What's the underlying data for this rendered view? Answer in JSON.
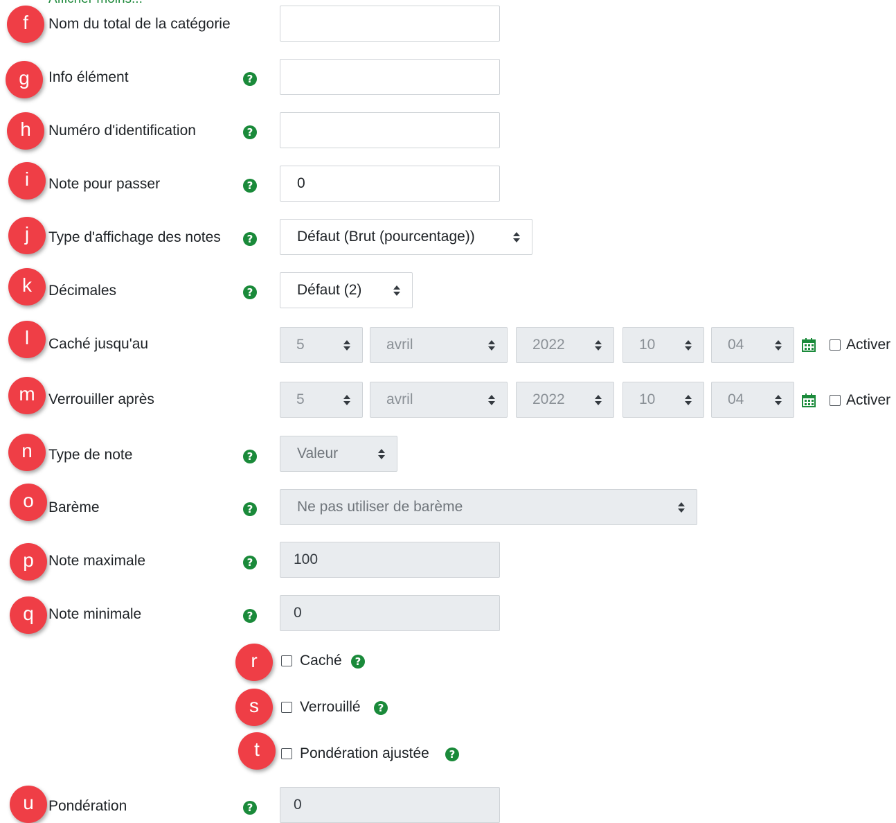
{
  "top_link": "Afficher moins...",
  "rows": [
    {
      "badge": "f",
      "label": "Nom du total de la catégorie",
      "value": ""
    },
    {
      "badge": "g",
      "label": "Info élément",
      "value": ""
    },
    {
      "badge": "h",
      "label": "Numéro d'identification",
      "value": ""
    },
    {
      "badge": "i",
      "label": "Note pour passer",
      "value": "0"
    },
    {
      "badge": "j",
      "label": "Type d'affichage des notes",
      "value": "Défaut (Brut (pourcentage))"
    },
    {
      "badge": "k",
      "label": "Décimales",
      "value": "Défaut (2)"
    },
    {
      "badge": "l",
      "label": "Caché jusqu'au"
    },
    {
      "badge": "m",
      "label": "Verrouiller après"
    },
    {
      "badge": "n",
      "label": "Type de note",
      "value": "Valeur"
    },
    {
      "badge": "o",
      "label": "Barème",
      "value": "Ne pas utiliser de barème"
    },
    {
      "badge": "p",
      "label": "Note maximale",
      "value": "100"
    },
    {
      "badge": "q",
      "label": "Note minimale",
      "value": "0"
    },
    {
      "badge": "u",
      "label": "Pondération",
      "value": "0"
    }
  ],
  "date_fields": [
    {
      "day": "5",
      "month": "avril",
      "year": "2022",
      "hour": "10",
      "minute": "04",
      "enable_label": "Activer"
    },
    {
      "day": "5",
      "month": "avril",
      "year": "2022",
      "hour": "10",
      "minute": "04",
      "enable_label": "Activer"
    }
  ],
  "checkboxes": [
    {
      "badge": "r",
      "label": "Caché"
    },
    {
      "badge": "s",
      "label": "Verrouillé"
    },
    {
      "badge": "t",
      "label": "Pondération ajustée"
    }
  ],
  "help_glyph": "?",
  "icons": {
    "help": "question-circle-icon",
    "calendar": "calendar-icon"
  },
  "colors": {
    "badge": "#ef3e46",
    "help": "#1a8a3a",
    "calendar": "#1a8a3a",
    "disabled_bg": "#e9ecef"
  }
}
